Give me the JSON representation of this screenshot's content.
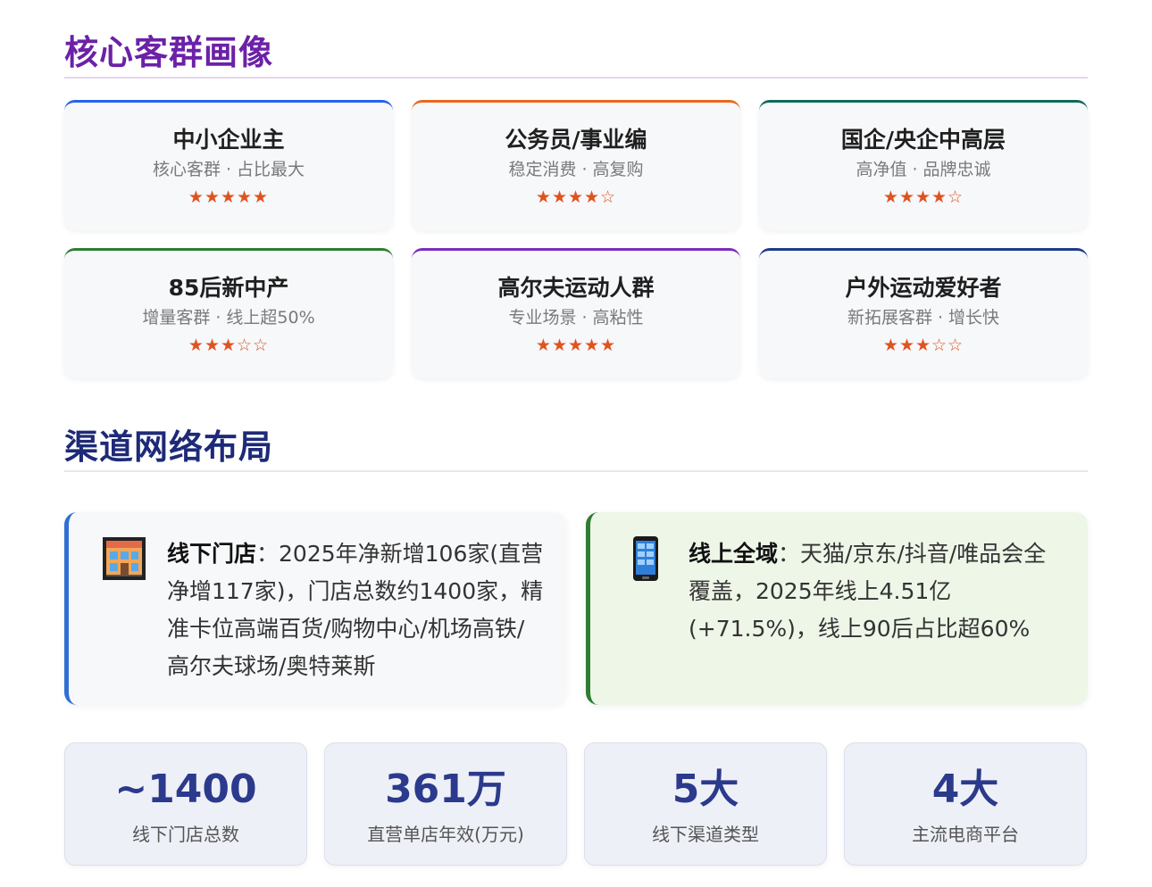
{
  "personas_section": {
    "title": "核心客群画像",
    "cards": [
      {
        "name": "中小企业主",
        "tags": "核心客群 · 占比最大",
        "stars": "★★★★★",
        "rating": 5,
        "accent": "#2563eb"
      },
      {
        "name": "公务员/事业编",
        "tags": "稳定消费 · 高复购",
        "stars": "★★★★☆",
        "rating": 4,
        "accent": "#e8691f"
      },
      {
        "name": "国企/央企中高层",
        "tags": "高净值 · 品牌忠诚",
        "stars": "★★★★☆",
        "rating": 4,
        "accent": "#0f6b5a"
      },
      {
        "name": "85后新中产",
        "tags": "增量客群 · 线上超50%",
        "stars": "★★★☆☆",
        "rating": 3,
        "accent": "#2e7d32"
      },
      {
        "name": "高尔夫运动人群",
        "tags": "专业场景 · 高粘性",
        "stars": "★★★★★",
        "rating": 5,
        "accent": "#7b2cbf"
      },
      {
        "name": "户外运动爱好者",
        "tags": "新拓展客群 · 增长快",
        "stars": "★★★☆☆",
        "rating": 3,
        "accent": "#1e3a8a"
      }
    ]
  },
  "channels_section": {
    "title": "渠道网络布局",
    "offline": {
      "icon": "store-building-icon",
      "label": "线下门店",
      "text": "：2025年净新增106家(直营净增117家)，门店总数约1400家，精准卡位高端百货/购物中心/机场高铁/高尔夫球场/奥特莱斯",
      "accent": "#2f6fd6"
    },
    "online": {
      "icon": "mobile-phone-icon",
      "label": "线上全域",
      "text": "：天猫/京东/抖音/唯品会全覆盖，2025年线上4.51亿(+71.5%)，线上90后占比超60%",
      "accent": "#2e7d32"
    }
  },
  "stats": [
    {
      "value": "~1400",
      "label": "线下门店总数"
    },
    {
      "value": "361万",
      "label": "直营单店年效(万元)"
    },
    {
      "value": "5大",
      "label": "线下渠道类型"
    },
    {
      "value": "4大",
      "label": "主流电商平台"
    }
  ],
  "colors": {
    "section1_title": "#6b21a8",
    "section2_title": "#1e2a78",
    "stars": "#e0531f",
    "stat_value": "#2b3a8c"
  }
}
